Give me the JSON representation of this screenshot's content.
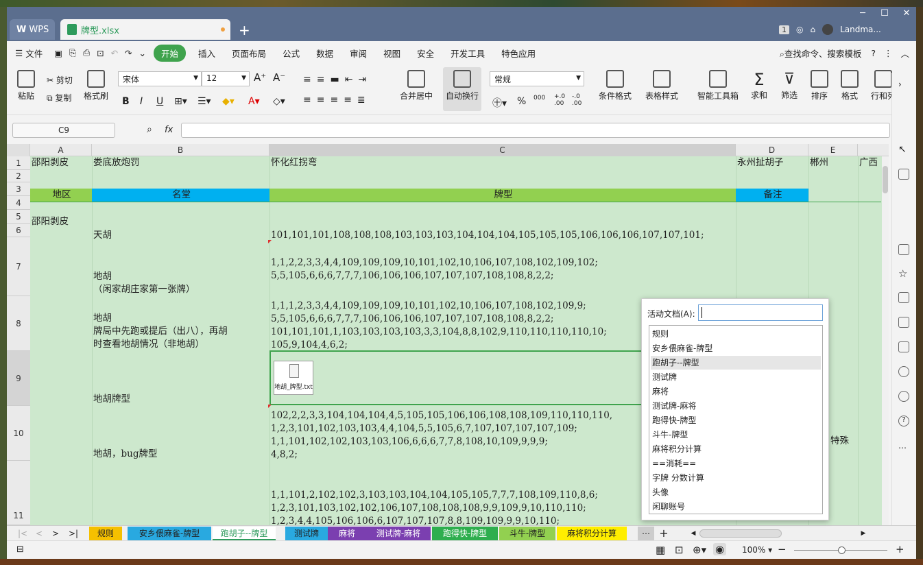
{
  "titlebar": {
    "wps_label": "WPS",
    "file_tab": "牌型.xlsx",
    "user": "Landma...",
    "window_count": "1"
  },
  "menu": [
    "文件",
    "开始",
    "插入",
    "页面布局",
    "公式",
    "数据",
    "审阅",
    "视图",
    "安全",
    "开发工具",
    "特色应用"
  ],
  "search_label": "查找命令、搜索模板",
  "ribbon": {
    "paste": "粘贴",
    "cut": "剪切",
    "copy": "复制",
    "format_painter": "格式刷",
    "font": "宋体",
    "font_size": "12",
    "merge": "合并居中",
    "wrap": "自动换行",
    "number_format": "常规",
    "cond_format": "条件格式",
    "table_style": "表格样式",
    "smart_toolbox": "智能工具箱",
    "sum": "求和",
    "filter": "筛选",
    "sort": "排序",
    "format": "格式",
    "rowcol": "行和列",
    "percent": "%",
    "thousands": "000",
    "dec_inc": "+.0\n.00",
    "dec_dec": "-.0\n.00"
  },
  "formula_bar": {
    "namebox": "C9",
    "fx": "fx",
    "formula": ""
  },
  "columns": [
    "A",
    "B",
    "C",
    "D",
    "E"
  ],
  "rows": {
    "r1": {
      "num": "1",
      "a": "邵阳剥皮",
      "b": "娄底放炮罚",
      "c": "怀化红拐弯",
      "d": "永州扯胡子",
      "e": "郴州",
      "f": "广西"
    },
    "r2": {
      "num": "2"
    },
    "r3": {
      "num": "3",
      "a": "地区",
      "b": "名堂",
      "c": "牌型",
      "d": "备注"
    },
    "r4": {
      "num": "4"
    },
    "r5": {
      "num": "5",
      "a": "邵阳剥皮"
    },
    "r6": {
      "num": "6",
      "b": "天胡",
      "c": "101,101,101,108,108,108,103,103,103,104,104,104,105,105,105,106,106,106,107,107,101;"
    },
    "r7": {
      "num": "7",
      "b": "地胡\n（闲家胡庄家第一张牌）",
      "c": "1,1,2,2,3,3,4,4,109,109,109,10,101,102,10,106,107,108,102,109,102;\n5,5,105,6,6,6,7,7,7,106,106,106,107,107,107,108,108,8,2,2;"
    },
    "r8": {
      "num": "8",
      "b": "地胡\n牌局中先跑或提后（出八），再胡\n时查看地胡情况（非地胡）",
      "c": "1,1,1,2,3,3,4,4,109,109,109,10,101,102,10,106,107,108,102,109,9;\n5,5,105,6,6,6,7,7,7,106,106,106,107,107,107,108,108,8,2,2;\n101,101,101,1,103,103,103,103,3,3,104,8,8,102,9,110,110,110,110,10;\n105,9,104,4,6,2;"
    },
    "r9": {
      "num": "9",
      "b": "地胡牌型",
      "attachment": "地胡_牌型.txt"
    },
    "r10": {
      "num": "10",
      "b": "地胡，bug牌型",
      "c": "102,2,2,3,3,104,104,104,4,5,105,105,106,106,108,108,109,110,110,110,\n1,2,3,101,102,103,103,4,4,104,5,5,105,6,7,107,107,107,107,109;\n1,1,101,102,102,103,103,106,6,6,6,7,7,8,108,10,109,9,9,9;\n4,8,2;",
      "e": "特殊"
    },
    "r11": {
      "num": "11",
      "c": "1,1,101,2,102,102,3,103,103,104,104,105,105,7,7,7,108,109,110,8,6;\n1,2,3,101,103,102,102,106,107,108,108,108,9,9,109,9,10,110,110;\n1,2,3,4,4,105,106,106,6,107,107,107,8,8,109,109,9,9,10,110;"
    }
  },
  "sheets": [
    {
      "label": "规则",
      "color": "#f5c000"
    },
    {
      "label": "安乡偎麻雀-牌型",
      "color": "#29a9e0"
    },
    {
      "label": "跑胡子--牌型",
      "color": "#ffffff"
    },
    {
      "label": "测试牌",
      "color": "#29a9e0"
    },
    {
      "label": "麻将",
      "color": "#7b3fb0"
    },
    {
      "label": "测试牌-麻将",
      "color": "#7b3fb0"
    },
    {
      "label": "跑得快-牌型",
      "color": "#2eae4e"
    },
    {
      "label": "斗牛-牌型",
      "color": "#92d050"
    },
    {
      "label": "麻将积分计算",
      "color": "#ffee00"
    }
  ],
  "status": {
    "zoom": "100%"
  },
  "popup": {
    "label": "活动文档(A):",
    "items": [
      "规则",
      "安乡偎麻雀-牌型",
      "跑胡子--牌型",
      "测试牌",
      "麻将",
      "测试牌-麻将",
      "跑得快-牌型",
      "斗牛-牌型",
      "麻将积分计算",
      "==消耗==",
      "字牌 分数计算",
      "头像",
      "闲聊账号"
    ],
    "selected_index": 2
  },
  "colors": {
    "header_blue": "#00b0f0",
    "header_green": "#92d050",
    "selection": "#3fa34d",
    "sheet_bg": "#cde8cd"
  }
}
